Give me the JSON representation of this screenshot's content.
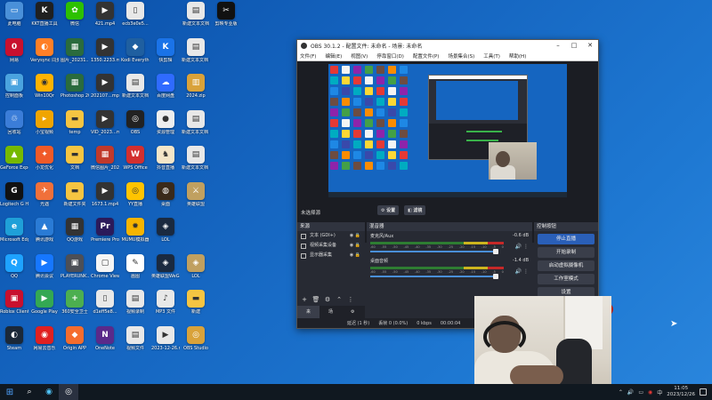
{
  "desktop": {
    "icons": [
      {
        "label": "此电脑",
        "color": "#4a90d9",
        "glyph": "▭"
      },
      {
        "label": "KKT直播工具",
        "color": "#202020",
        "glyph": "K"
      },
      {
        "label": "微信",
        "color": "#2dc100",
        "glyph": "✿"
      },
      {
        "label": "421.mp4",
        "color": "#333",
        "glyph": "▶"
      },
      {
        "label": "ecb3e0e5...",
        "color": "#e8e8e8",
        "glyph": "▯"
      },
      {
        "label": "",
        "color": "",
        "glyph": ""
      },
      {
        "label": "新建文本文档",
        "color": "#e8e8e8",
        "glyph": "▤"
      },
      {
        "label": "剪映专业版",
        "color": "#111",
        "glyph": "✂"
      },
      {
        "label": "网易",
        "color": "#c8102e",
        "glyph": "0"
      },
      {
        "label": "Verysync 同步",
        "color": "#ff7f27",
        "glyph": "◐"
      },
      {
        "label": "图片_20231...",
        "color": "#2a6b3d",
        "glyph": "▦"
      },
      {
        "label": "1350.2233.mp4",
        "color": "#333",
        "glyph": "▶"
      },
      {
        "label": "Kodi Everything...",
        "color": "#1f5fa0",
        "glyph": "◆"
      },
      {
        "label": "快剪辑",
        "color": "#1a73e8",
        "glyph": "K"
      },
      {
        "label": "新建文本文档 (2)",
        "color": "#e8e8e8",
        "glyph": "▤"
      },
      {
        "label": "",
        "color": "",
        "glyph": ""
      },
      {
        "label": "控制面板",
        "color": "#4aa3df",
        "glyph": "▣"
      },
      {
        "label": "Win10Qr",
        "color": "#ffb300",
        "glyph": "◉"
      },
      {
        "label": "Photoshop 2021",
        "color": "#2a6b3d",
        "glyph": "▦"
      },
      {
        "label": "202107...mp4",
        "color": "#333",
        "glyph": "▶"
      },
      {
        "label": "新建文本文档",
        "color": "#e8e8e8",
        "glyph": "▤"
      },
      {
        "label": "百度网盘",
        "color": "#2f6bff",
        "glyph": "☁"
      },
      {
        "label": "2024.zip",
        "color": "#d9a23a",
        "glyph": "▥"
      },
      {
        "label": "",
        "color": "",
        "glyph": ""
      },
      {
        "label": "回收站",
        "color": "#3b7dd8",
        "glyph": "♲"
      },
      {
        "label": "小宝视频",
        "color": "#f0a500",
        "glyph": "▸"
      },
      {
        "label": "temp",
        "color": "#f5c542",
        "glyph": "▬"
      },
      {
        "label": "VID_2023...mp4",
        "color": "#333",
        "glyph": "▶"
      },
      {
        "label": "OBS",
        "color": "#222",
        "glyph": "◎"
      },
      {
        "label": "资源管理",
        "color": "#eee",
        "glyph": "●"
      },
      {
        "label": "新建文本文档 2023...",
        "color": "#e8e8e8",
        "glyph": "▤"
      },
      {
        "label": "",
        "color": "",
        "glyph": ""
      },
      {
        "label": "GeForce Experience",
        "color": "#76b900",
        "glyph": "▲"
      },
      {
        "label": "小龙优化",
        "color": "#f05a28",
        "glyph": "✦"
      },
      {
        "label": "文档",
        "color": "#f5c542",
        "glyph": "▬"
      },
      {
        "label": "微信图片_2023...",
        "color": "#c0392b",
        "glyph": "▦"
      },
      {
        "label": "WPS Office",
        "color": "#d32f2f",
        "glyph": "W"
      },
      {
        "label": "抖音直播",
        "color": "#f5e6c8",
        "glyph": "♞"
      },
      {
        "label": "新建文本文档 2023...",
        "color": "#e8e8e8",
        "glyph": "▤"
      },
      {
        "label": "",
        "color": "",
        "glyph": ""
      },
      {
        "label": "Logitech G HUB",
        "color": "#111",
        "glyph": "G"
      },
      {
        "label": "光遇",
        "color": "#f0703a",
        "glyph": "✈"
      },
      {
        "label": "新建文件夹",
        "color": "#f5c542",
        "glyph": "▬"
      },
      {
        "label": "1673.1.mp4",
        "color": "#333",
        "glyph": "▶"
      },
      {
        "label": "YY直播",
        "color": "#ffc400",
        "glyph": "◎"
      },
      {
        "label": "桌面",
        "color": "#3a2a1a",
        "glyph": "◍"
      },
      {
        "label": "英雄联盟",
        "color": "#c0a060",
        "glyph": "⚔"
      },
      {
        "label": "",
        "color": "",
        "glyph": ""
      },
      {
        "label": "Microsoft Edge",
        "color": "#1fa0d8",
        "glyph": "e"
      },
      {
        "label": "腾讯游戏",
        "color": "#2a7bd5",
        "glyph": "▲"
      },
      {
        "label": "QQ游戏",
        "color": "#333",
        "glyph": "▦"
      },
      {
        "label": "Premiere Pro",
        "color": "#2b1a5a",
        "glyph": "Pr"
      },
      {
        "label": "MUMU模拟器",
        "color": "#f6b400",
        "glyph": "✹"
      },
      {
        "label": "LOL",
        "color": "#1a2a40",
        "glyph": "◈"
      },
      {
        "label": "",
        "color": "",
        "glyph": ""
      },
      {
        "label": "",
        "color": "",
        "glyph": ""
      },
      {
        "label": "QQ",
        "color": "#1ea3ff",
        "glyph": "Q"
      },
      {
        "label": "腾讯会议",
        "color": "#1677ff",
        "glyph": "▶"
      },
      {
        "label": "PLAYERUNK...",
        "color": "#4c4f57",
        "glyph": "▣"
      },
      {
        "label": "Chrome Viewer",
        "color": "#f5f5f5",
        "glyph": "▢"
      },
      {
        "label": "画图",
        "color": "#ffffff",
        "glyph": "✎"
      },
      {
        "label": "英雄联盟WeGame版",
        "color": "#1a2a40",
        "glyph": "◈"
      },
      {
        "label": "LOL",
        "color": "#c0a060",
        "glyph": "◈"
      },
      {
        "label": "",
        "color": "",
        "glyph": ""
      },
      {
        "label": "Roblox Client",
        "color": "#c8102e",
        "glyph": "▣"
      },
      {
        "label": "Google Play",
        "color": "#34a853",
        "glyph": "▶"
      },
      {
        "label": "360安全卫士",
        "color": "#4caf50",
        "glyph": "+"
      },
      {
        "label": "d1eff5e8...",
        "color": "#e8e8e8",
        "glyph": "▯"
      },
      {
        "label": "视频录制",
        "color": "#e8e8e8",
        "glyph": "▤"
      },
      {
        "label": "MP3 文件",
        "color": "#e8e8e8",
        "glyph": "♪"
      },
      {
        "label": "新建",
        "color": "#f5c542",
        "glyph": "▬"
      },
      {
        "label": "",
        "color": "",
        "glyph": ""
      },
      {
        "label": "Steam",
        "color": "#1b2838",
        "glyph": "◐"
      },
      {
        "label": "网易云音乐",
        "color": "#e02020",
        "glyph": "◉"
      },
      {
        "label": "Origin APP",
        "color": "#f56c2d",
        "glyph": "◆"
      },
      {
        "label": "OneNote",
        "color": "#5a2a8a",
        "glyph": "N"
      },
      {
        "label": "视频文件",
        "color": "#e8e8e8",
        "glyph": "▤"
      },
      {
        "label": "2023-12-26.mp4",
        "color": "#e8e8e8",
        "glyph": "▶"
      },
      {
        "label": "OBS Studio",
        "color": "#d9a23a",
        "glyph": "◎"
      },
      {
        "label": "",
        "color": "",
        "glyph": ""
      }
    ]
  },
  "obs": {
    "title": "OBS 30.1.2 - 配置文件: 未命名 - 场景: 未命名",
    "menu": [
      "文件(F)",
      "编辑(E)",
      "视图(V)",
      "停靠窗口(D)",
      "配置文件(P)",
      "场景集合(S)",
      "工具(T)",
      "帮助(H)"
    ],
    "no_source_label": "未选择源",
    "settings_button": "设置",
    "filters_button": "滤镜",
    "sources_header": "来源",
    "sources": [
      {
        "name": "文本 (GDI+)"
      },
      {
        "name": "视频采集设备"
      },
      {
        "name": "显示器采集"
      }
    ],
    "tabs": [
      "来源",
      "场景"
    ],
    "mixer_header": "混音器",
    "mixer": [
      {
        "name": "麦克风/Aux",
        "db": "-0.6 dB"
      },
      {
        "name": "桌面音频",
        "db": "-1.4 dB"
      }
    ],
    "scale_ticks": [
      "-60",
      "-55",
      "-50",
      "-45",
      "-40",
      "-35",
      "-30",
      "-25",
      "-20",
      "-15",
      "-10",
      "-5",
      "0"
    ],
    "controls_header": "控制按钮",
    "controls": [
      "停止直播",
      "开始录制",
      "启动虚拟摄像机",
      "工作室模式",
      "设置"
    ],
    "status": {
      "delay": "延迟 (1 秒)",
      "dropped": "丢帧 0 (0.0%)",
      "bitrate": "0 kbps",
      "time": "00:00:04"
    }
  },
  "taskbar": {
    "time": "11:05",
    "date": "2023/12/26"
  }
}
